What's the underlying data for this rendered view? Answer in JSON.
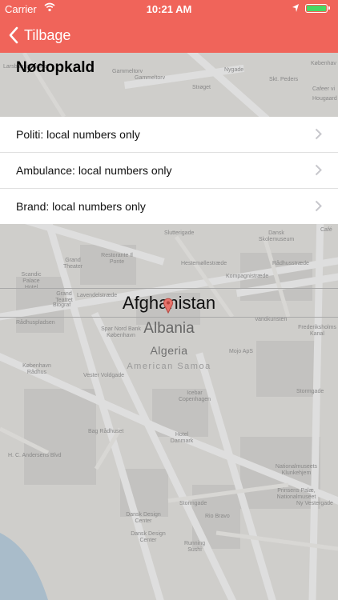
{
  "status": {
    "carrier": "Carrier",
    "time": "10:21 AM",
    "battery_color": "#48d763"
  },
  "nav": {
    "back_label": "Tilbage",
    "bar_color": "#f0645a"
  },
  "page": {
    "title": "Nødopkald"
  },
  "emergency_list": [
    {
      "label": "Politi: local numbers only"
    },
    {
      "label": "Ambulance: local numbers only"
    },
    {
      "label": "Brand: local numbers only"
    }
  ],
  "country_picker": {
    "selected": "Afghanistan",
    "options": [
      "Albania",
      "Algeria",
      "American Samoa"
    ]
  },
  "map_labels": [
    "Gammeltorv",
    "Gammeltorv",
    "Strøget",
    "Nygade",
    "Larsbjørnsstræde",
    "Københav",
    "Skt. Peders",
    "Cafeer vi",
    "Hougaard",
    "Slutterigade",
    "Dansk Skolemuseum",
    "Café",
    "Restorante Il Ponte",
    "Grand Theater",
    "Scandic Palace Hotel",
    "Grand Teatret",
    "Biograf",
    "Hestemøllestræde",
    "Kompagnistræde",
    "Rådhusstræde",
    "Frederiksholms Kanal",
    "Vandkunsten",
    "Spar Nord Bank København",
    "Mojo ApS",
    "Rådhuspladsen",
    "København Rådhus",
    "Vester Voldgade",
    "Icebar Copenhagen",
    "Stormgade",
    "Bag Rådhuset",
    "Hotel Danmark",
    "H. C. Andersens Blvd",
    "Nationalmuseets Klunkehjem",
    "Prinsens Palæ, Nationalmuseet",
    "Ny Vestergade",
    "Dansk Design Center",
    "Dansk Design Center",
    "Rio Bravo",
    "Running Sushi",
    "Lavendelstræde",
    "Stormgade"
  ]
}
